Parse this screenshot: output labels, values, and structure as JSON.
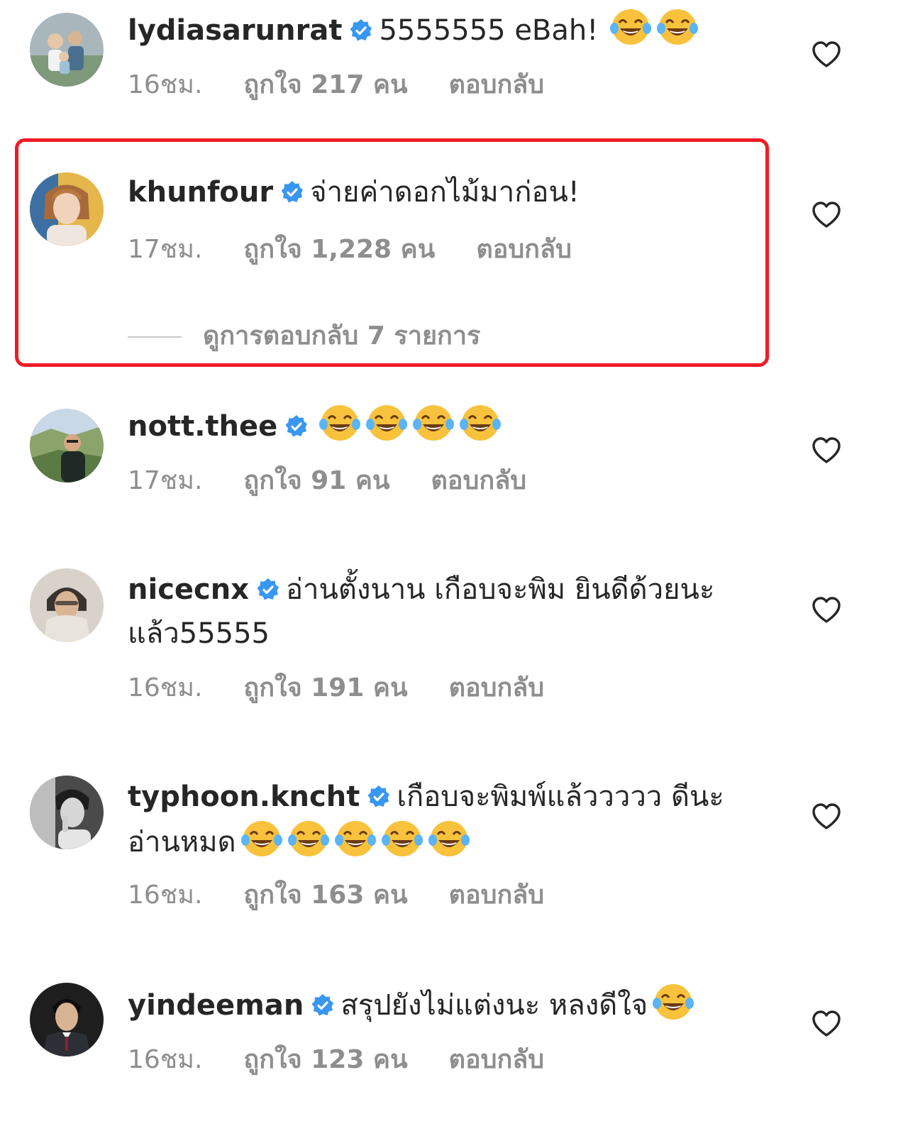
{
  "comments": [
    {
      "username": "lydiasarunrat",
      "text": "5555555 eBah!",
      "time": "16ชม.",
      "likes": "ถูกใจ 217 คน",
      "reply_label": "ตอบกลับ",
      "verified": true,
      "emoji_count": 2,
      "avatar_color": "#8c9aa3"
    },
    {
      "username": "khunfour",
      "text": "จ่ายค่าดอกไม้มาก่อน!",
      "time": "17ชม.",
      "likes": "ถูกใจ 1,228 คน",
      "reply_label": "ตอบกลับ",
      "verified": true,
      "emoji_count": 0,
      "view_replies": "ดูการตอบกลับ 7 รายการ",
      "highlighted": true,
      "avatar_color": "#d9a06b"
    },
    {
      "username": "nott.thee",
      "text": "",
      "time": "17ชม.",
      "likes": "ถูกใจ 91 คน",
      "reply_label": "ตอบกลับ",
      "verified": true,
      "emoji_count": 4,
      "avatar_color": "#6f8a5b"
    },
    {
      "username": "nicecnx",
      "text": "อ่านตั้งนาน เกือบจะพิม ยินดีด้วยนะ แล้ว55555",
      "time": "16ชม.",
      "likes": "ถูกใจ 191 คน",
      "reply_label": "ตอบกลับ",
      "verified": true,
      "emoji_count": 0,
      "avatar_color": "#b6aea4"
    },
    {
      "username": "typhoon.kncht",
      "text": "เกือบจะพิมพ์แล้ววววว ดีนะอ่านหมด",
      "time": "16ชม.",
      "likes": "ถูกใจ 163 คน",
      "reply_label": "ตอบกลับ",
      "verified": true,
      "emoji_count": 5,
      "avatar_color": "#5a5a5a"
    },
    {
      "username": "yindeeman",
      "text": "สรุปยังไม่แต่งนะ หลงดีใจ",
      "time": "16ชม.",
      "likes": "ถูกใจ 123 คน",
      "reply_label": "ตอบกลับ",
      "verified": true,
      "emoji_count": 1,
      "avatar_color": "#2b2b2b"
    }
  ],
  "colors": {
    "text": "#262626",
    "meta": "#8e8e8e",
    "verified": "#3897f0",
    "highlight_border": "#ee1c25"
  },
  "icons": {
    "verified": "verified-badge-icon",
    "like": "heart-outline-icon",
    "emoji": "face-with-tears-of-joy-icon"
  }
}
